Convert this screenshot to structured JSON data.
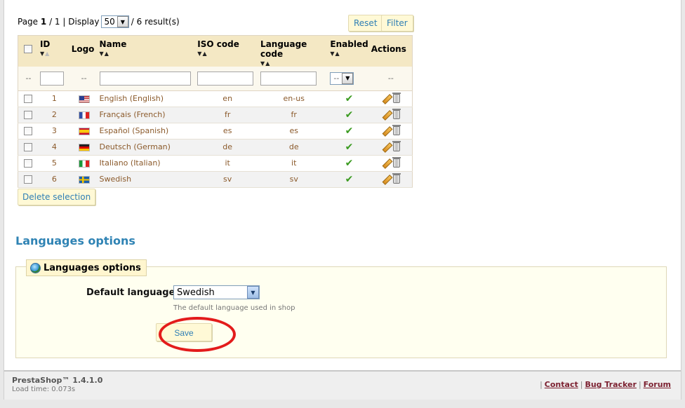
{
  "pager": {
    "page_label": "Page",
    "current_page": "1",
    "of_text": "/ 1 | Display",
    "per_page": "50",
    "results_text": "/ 6 result(s)"
  },
  "toolbar": {
    "reset_label": "Reset",
    "filter_label": "Filter"
  },
  "table": {
    "columns": [
      "ID",
      "Logo",
      "Name",
      "ISO code",
      "Language code",
      "Enabled",
      "Actions"
    ],
    "filter_placeholder": "--",
    "enabled_filter_value": "--",
    "rows": [
      {
        "id": "1",
        "flag": "flag-us",
        "name": "English (English)",
        "iso": "en",
        "code": "en-us",
        "enabled": "check-icon"
      },
      {
        "id": "2",
        "flag": "flag-fr",
        "name": "Français (French)",
        "iso": "fr",
        "code": "fr",
        "enabled": "check-icon"
      },
      {
        "id": "3",
        "flag": "flag-es",
        "name": "Español (Spanish)",
        "iso": "es",
        "code": "es",
        "enabled": "check-icon"
      },
      {
        "id": "4",
        "flag": "flag-de",
        "name": "Deutsch (German)",
        "iso": "de",
        "code": "de",
        "enabled": "check-icon"
      },
      {
        "id": "5",
        "flag": "flag-it",
        "name": "Italiano (Italian)",
        "iso": "it",
        "code": "it",
        "enabled": "check-icon"
      },
      {
        "id": "6",
        "flag": "flag-se",
        "name": "Swedish",
        "iso": "sv",
        "code": "sv",
        "enabled": "check-icon"
      }
    ]
  },
  "delete_selection_label": "Delete selection",
  "options": {
    "section_title": "Languages options",
    "legend": "Languages options",
    "default_language_label": "Default language:",
    "default_language_value": "Swedish",
    "hint": "The default language used in shop",
    "save_label": "Save"
  },
  "footer": {
    "version": "PrestaShop™ 1.4.1.0",
    "load_time": "Load time: 0.073s",
    "sep": "|",
    "links": [
      "Contact",
      "Bug Tracker",
      "Forum"
    ]
  },
  "colors": {
    "accent": "#2f83b4",
    "highlight_circle": "#e31b1b",
    "header_bg": "#f4e8c4"
  }
}
